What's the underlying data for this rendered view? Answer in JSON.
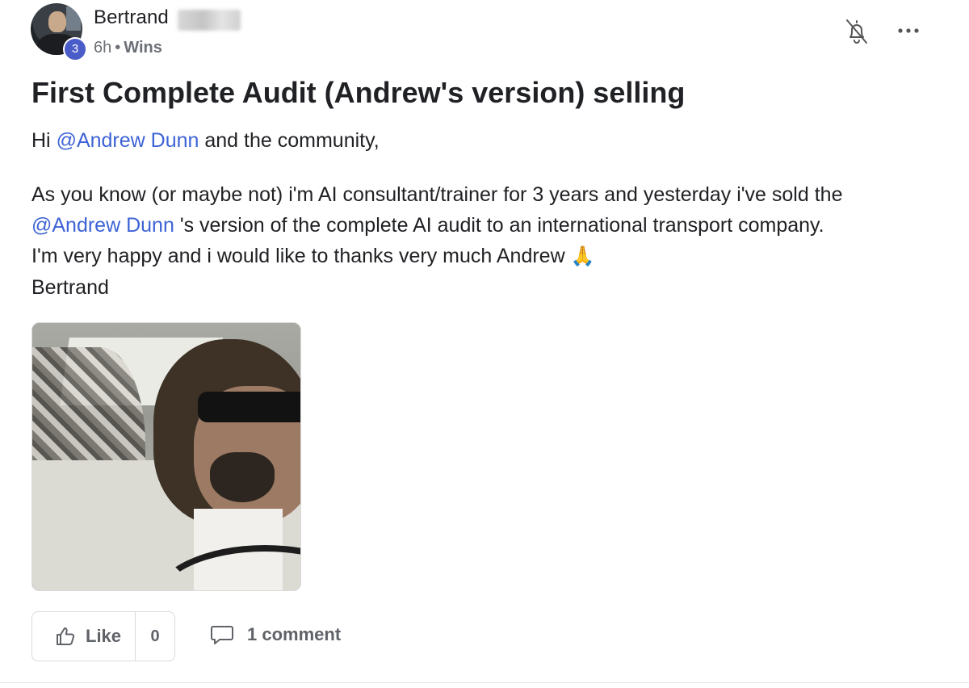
{
  "post": {
    "author": {
      "name": "Bertrand",
      "level": "3"
    },
    "meta": {
      "time": "6h",
      "separator": "•",
      "category": "Wins"
    },
    "title": "First Complete Audit (Andrew's version) selling",
    "greeting": {
      "prefix": "Hi",
      "mention": "@Andrew Dunn",
      "suffix": "and the community,"
    },
    "body": {
      "line1": "As you know (or maybe not) i'm AI consultant/trainer for 3 years and yesterday i've sold the",
      "mention": "@Andrew Dunn",
      "line2_rest": "'s version of the complete AI audit to an international transport company.",
      "line3": "I'm very happy and i would like to thanks very much Andrew",
      "emoji": "🙏",
      "signature": "Bertrand"
    },
    "actions": {
      "like_label": "Like",
      "like_count": "0",
      "comment_label": "1 comment"
    },
    "icons": {
      "bell": "bell-off-icon",
      "more": "more-horizontal-icon",
      "like": "thumbs-up-icon",
      "comment": "comment-icon"
    },
    "colors": {
      "mention": "#3d63d6",
      "level_badge": "#4a5cc8",
      "muted_text": "#5f6368"
    }
  }
}
